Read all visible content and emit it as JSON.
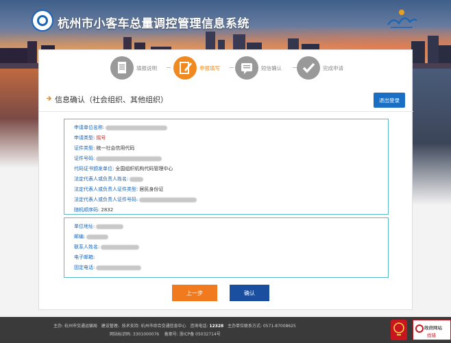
{
  "header": {
    "app_title": "杭州市小客车总量调控管理信息系统"
  },
  "steps": [
    {
      "label": "填报说明",
      "icon": "document-icon"
    },
    {
      "label": "申报填写",
      "icon": "edit-icon"
    },
    {
      "label": "短信确认",
      "icon": "message-icon"
    },
    {
      "label": "完成申请",
      "icon": "check-icon"
    }
  ],
  "active_step": 1,
  "page": {
    "title": "信息确认（社会组织、其他组织）",
    "logout_label": "退出登录"
  },
  "section1": [
    {
      "key": "申请单位名称:",
      "value": ""
    },
    {
      "key": "申请类型:",
      "value": "摇号"
    },
    {
      "key": "证件类型:",
      "value": "统一社会信用代码"
    },
    {
      "key": "证件号码:",
      "value": ""
    },
    {
      "key": "代码证书颁发单位:",
      "value": "全国组织机构代码管理中心"
    },
    {
      "key": "法定代表人或负责人姓名:",
      "value": ""
    },
    {
      "key": "法定代表人或负责人证件类型:",
      "value": "居民身份证"
    },
    {
      "key": "法定代表人或负责人证件号码:",
      "value": ""
    },
    {
      "key": "随机顺序码:",
      "value": "2832"
    }
  ],
  "section2": [
    {
      "key": "单位地址:",
      "value": ""
    },
    {
      "key": "邮编:",
      "value": ""
    },
    {
      "key": "联系人姓名:",
      "value": ""
    },
    {
      "key": "电子邮箱:",
      "value": ""
    },
    {
      "key": "固定电话:",
      "value": ""
    }
  ],
  "buttons": {
    "prev": "上一步",
    "confirm": "确认"
  },
  "footer": {
    "line1_host_label": "主办:",
    "line1_host": "杭州市交通运输局",
    "line1_support": "建设管理、技术支持: 杭州市综合交通信息中心",
    "line1_phone_label": "咨询电话:",
    "line1_phone": "12328",
    "line1_contact": "主办单位联系方式: 0571-87008625",
    "line2_site_id": "网站标识码: 3301000076",
    "line2_icp": "备案号: 浙ICP备 05032714号",
    "badge_title": "政府网站",
    "badge_sub": "找错"
  },
  "colors": {
    "accent_orange": "#f08a20",
    "brand_blue": "#1a6fc4",
    "confirm_blue": "#1a4fa0",
    "box_border": "#58b8c8",
    "label_blue": "#1a64b5",
    "highlight_red": "#e02020"
  }
}
